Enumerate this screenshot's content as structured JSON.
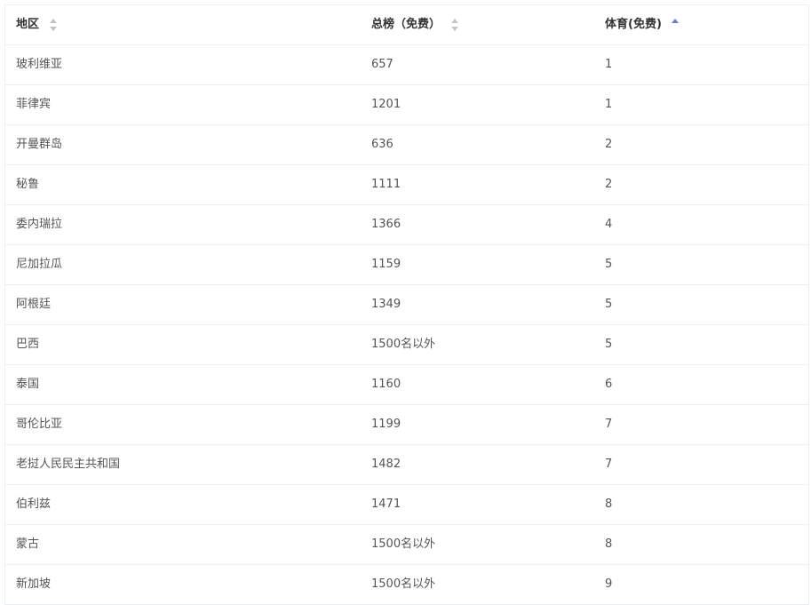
{
  "table": {
    "columns": [
      {
        "label": "地区",
        "sort_state": "none"
      },
      {
        "label": "总榜（免费）",
        "sort_state": "none"
      },
      {
        "label": "体育(免费)",
        "sort_state": "ascending"
      }
    ],
    "rows": [
      [
        "玻利维亚",
        "657",
        "1"
      ],
      [
        "菲律宾",
        "1201",
        "1"
      ],
      [
        "开曼群岛",
        "636",
        "2"
      ],
      [
        "秘鲁",
        "1111",
        "2"
      ],
      [
        "委内瑞拉",
        "1366",
        "4"
      ],
      [
        "尼加拉瓜",
        "1159",
        "5"
      ],
      [
        "阿根廷",
        "1349",
        "5"
      ],
      [
        "巴西",
        "1500名以外",
        "5"
      ],
      [
        "泰国",
        "1160",
        "6"
      ],
      [
        "哥伦比亚",
        "1199",
        "7"
      ],
      [
        "老挝人民民主共和国",
        "1482",
        "7"
      ],
      [
        "伯利兹",
        "1471",
        "8"
      ],
      [
        "蒙古",
        "1500名以外",
        "8"
      ],
      [
        "新加坡",
        "1500名以外",
        "9"
      ]
    ]
  },
  "colors": {
    "border": "#ebeef5",
    "sort_inactive": "#c0c4cc",
    "sort_active": "#6c7fd8",
    "text": "#333333"
  },
  "icons": {
    "sort": "sort-caret-icon"
  }
}
